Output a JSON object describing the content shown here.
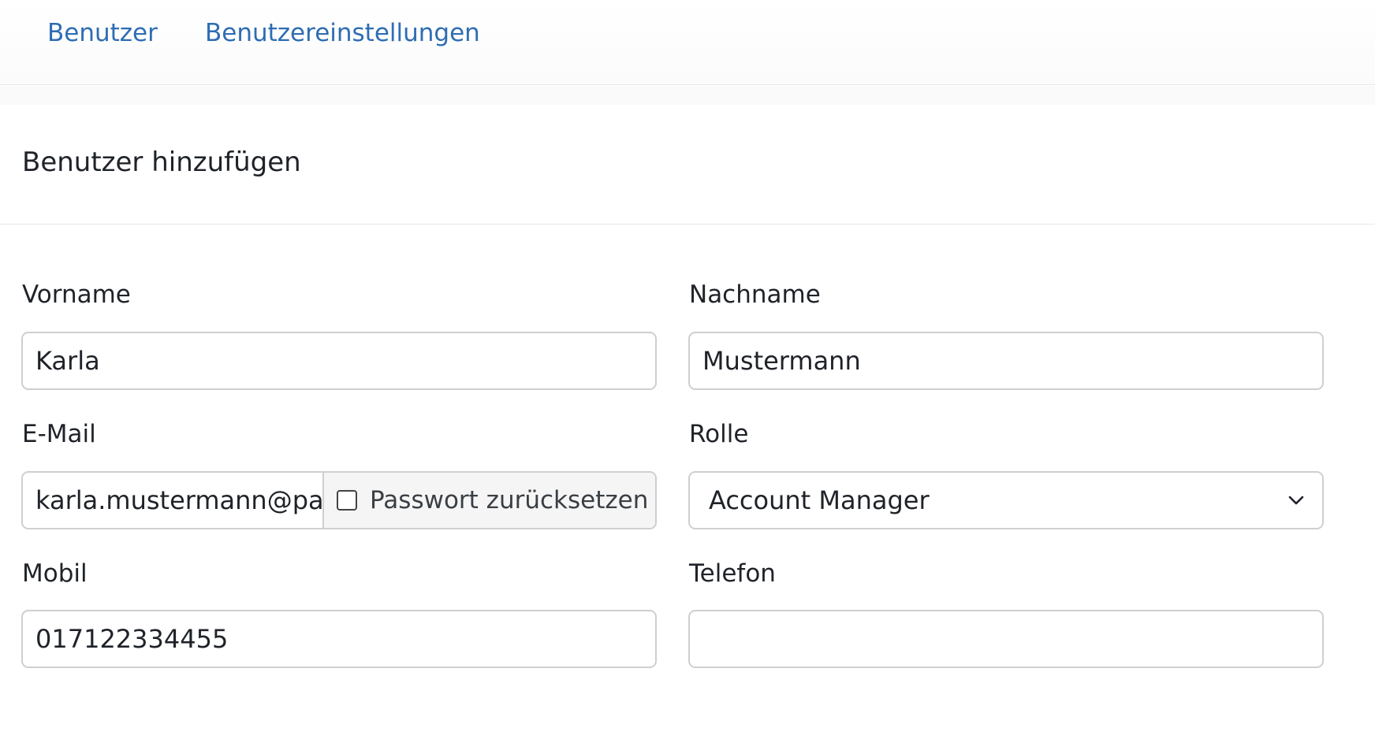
{
  "nav": {
    "tabs": [
      {
        "label": "Benutzer"
      },
      {
        "label": "Benutzereinstellungen"
      }
    ]
  },
  "card": {
    "title": "Benutzer hinzufügen"
  },
  "form": {
    "first_name": {
      "label": "Vorname",
      "value": "Karla"
    },
    "last_name": {
      "label": "Nachname",
      "value": "Mustermann"
    },
    "email": {
      "label": "E-Mail",
      "value": "karla.mustermann@pa",
      "reset_password_label": "Passwort zurücksetzen",
      "reset_password_checked": false
    },
    "role": {
      "label": "Rolle",
      "value": "Account Manager"
    },
    "mobile": {
      "label": "Mobil",
      "value": "017122334455"
    },
    "phone": {
      "label": "Telefon",
      "value": ""
    }
  },
  "colors": {
    "link": "#2e6db4",
    "border": "#cfcfcf",
    "addon_bg": "#f5f5f5"
  },
  "icons": {
    "select_arrow": "chevron-down-icon"
  }
}
